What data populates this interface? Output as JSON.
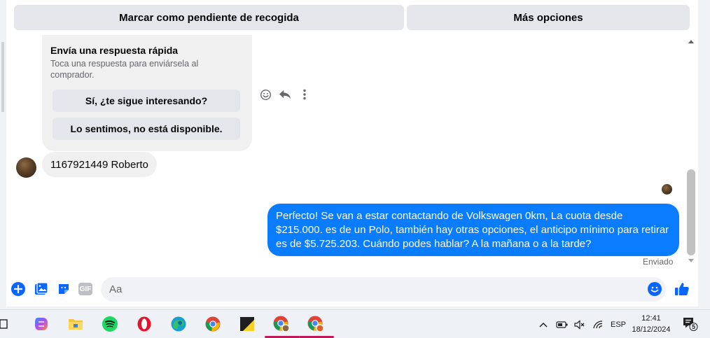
{
  "topbar": {
    "mark_pending_label": "Marcar como pendiente de recogida",
    "more_options_label": "Más opciones"
  },
  "quick_reply": {
    "title": "Envía una respuesta rápida",
    "subtitle": "Toca una respuesta para enviársela al comprador.",
    "options": [
      "Sí, ¿te sigue interesando?",
      "Lo sentimos, no está disponible."
    ]
  },
  "messages": {
    "incoming_text": "1167921449 Roberto",
    "outgoing_text": "Perfecto!  Se van a estar contactando de Volkswagen 0km, La cuota desde $215.000. es de un Polo, también hay otras opciones, el anticipo mínimo para retirar es de $5.725.203. Cuándo podes hablar? A la mañana o a la tarde?",
    "status": "Enviado"
  },
  "composer": {
    "placeholder": "Aa",
    "gif_label": "GIF"
  },
  "taskbar": {
    "language": "ESP",
    "time": "12:41",
    "date": "18/12/2024",
    "notification_count": "5"
  },
  "colors": {
    "accent": "#0a7cff",
    "icon_blue": "#0866ff",
    "bubble_gray": "#f0f0f0",
    "button_gray": "#e4e6eb"
  }
}
